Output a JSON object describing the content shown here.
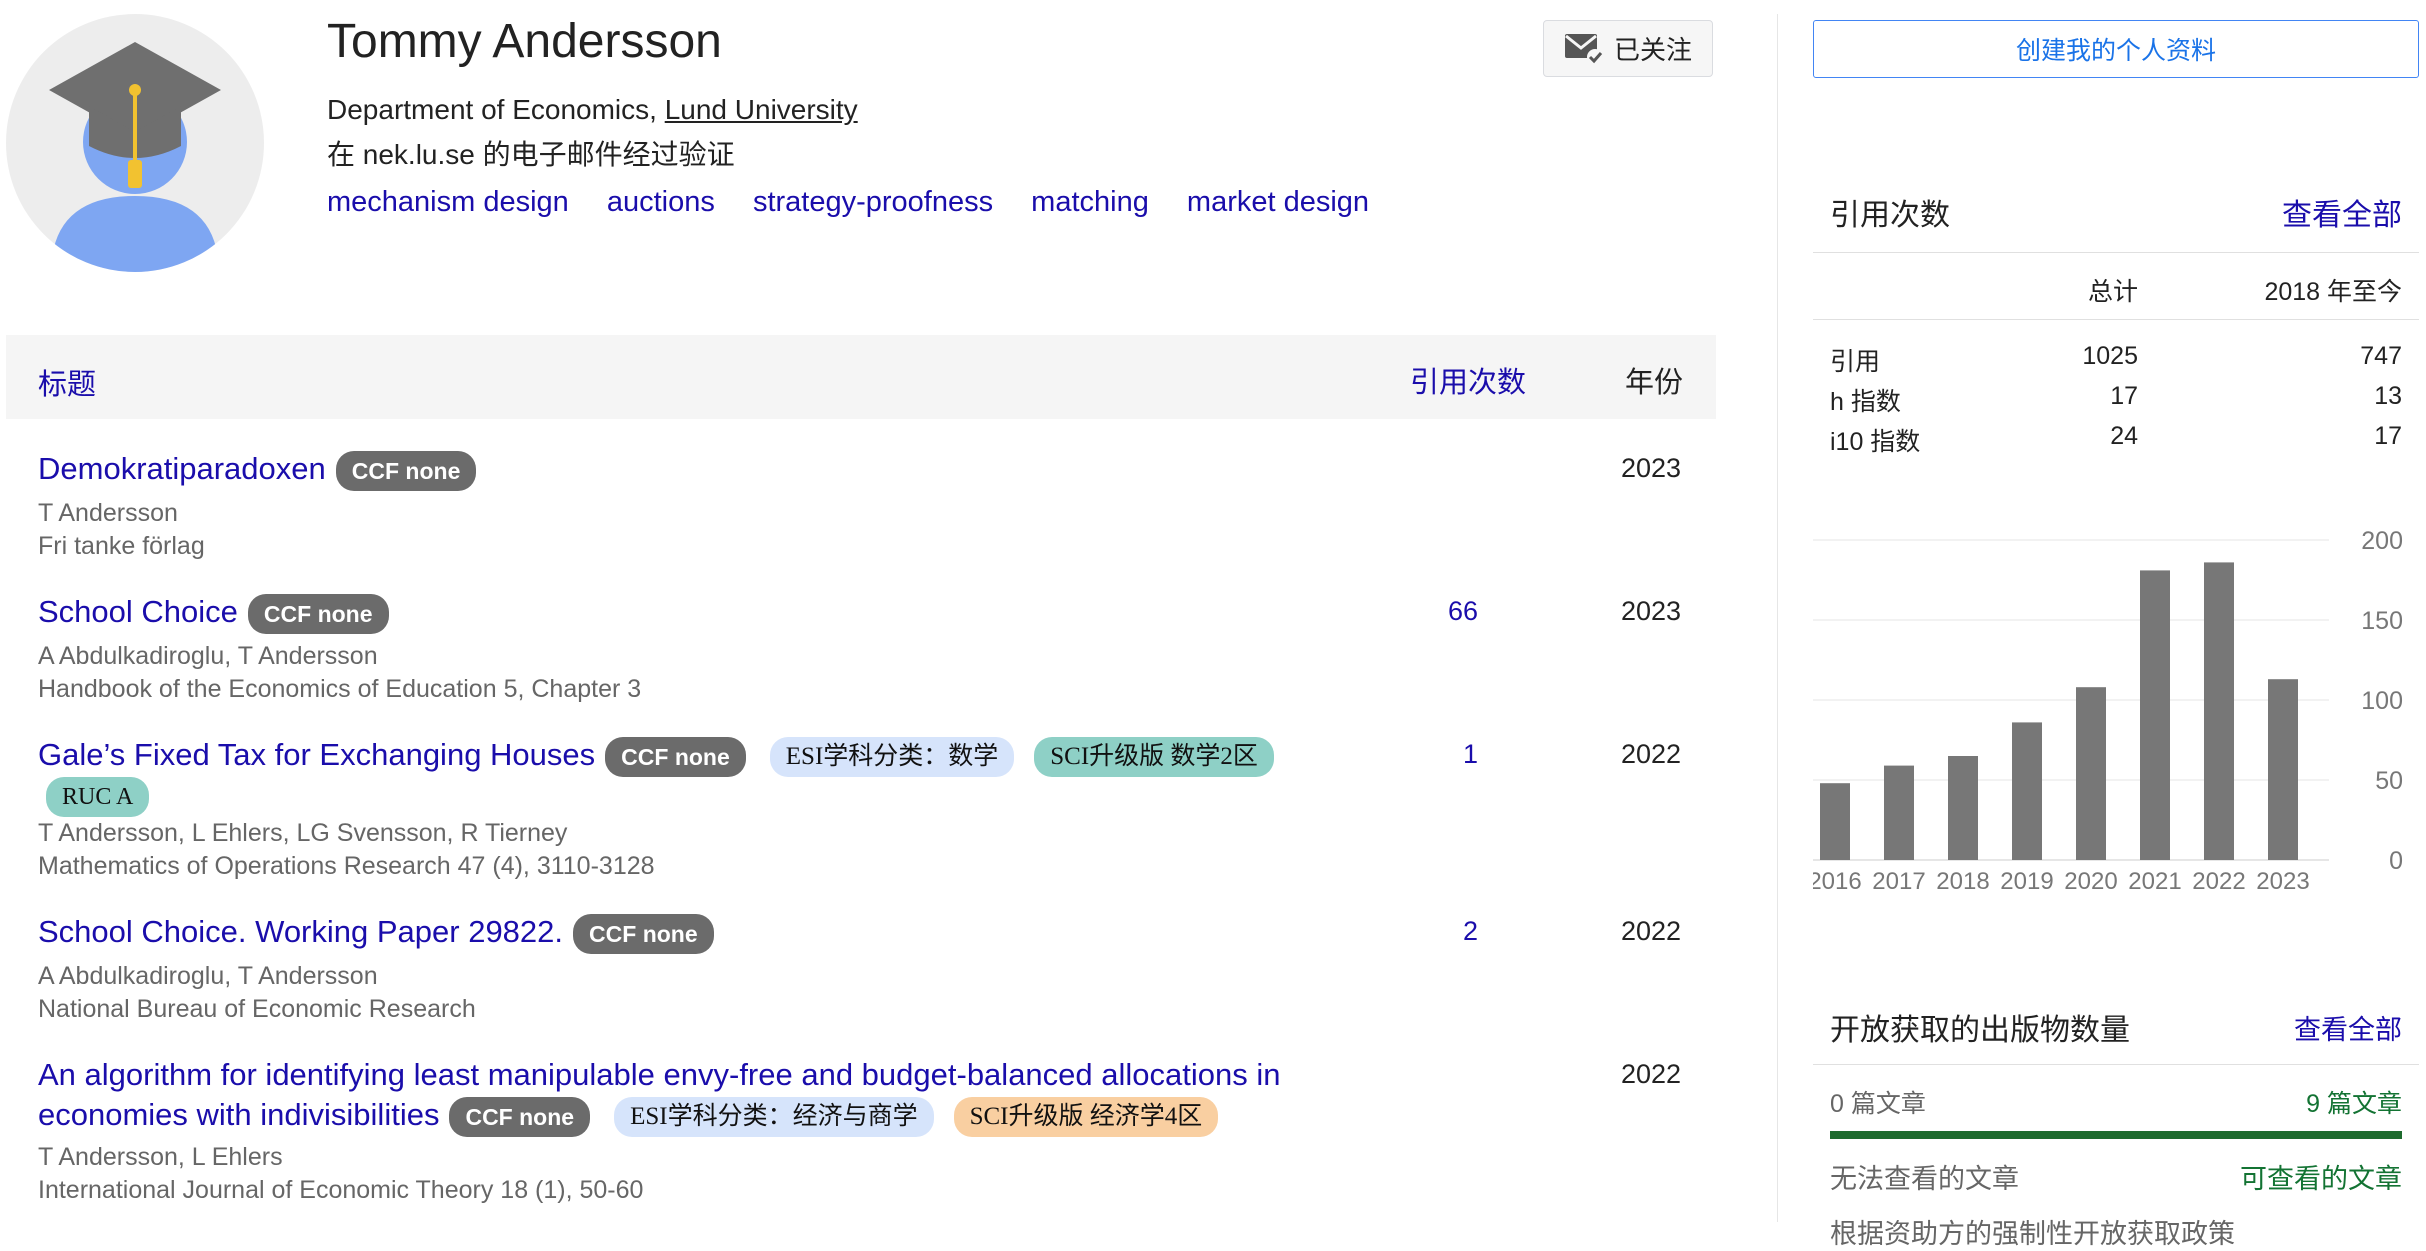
{
  "profile": {
    "name": "Tommy Andersson",
    "affiliation_prefix": "Department of Economics, ",
    "affiliation_univ": "Lund University",
    "verified": "在 nek.lu.se 的电子邮件经过验证",
    "interests": [
      "mechanism design",
      "auctions",
      "strategy-proofness",
      "matching",
      "market design"
    ],
    "follow_label": "已关注"
  },
  "table": {
    "col_title": "标题",
    "col_cites": "引用次数",
    "col_year": "年份",
    "ccf_badge": "CCF none",
    "rows": [
      {
        "title": "Demokratiparadoxen",
        "authors": "T Andersson",
        "venue": "Fri tanke förlag",
        "cites": "",
        "year": "2023"
      },
      {
        "title": "School Choice",
        "authors": "A Abdulkadiroglu, T Andersson",
        "venue": "Handbook of the Economics of Education 5, Chapter 3",
        "cites": "66",
        "year": "2023"
      },
      {
        "title": "Gale’s Fixed Tax for Exchanging Houses",
        "esi": "ESI学科分类：数学",
        "sci": "SCI升级版 数学2区",
        "ruc": "RUC A",
        "authors": "T Andersson, L Ehlers, LG Svensson, R Tierney",
        "venue": "Mathematics of Operations Research 47 (4), 3110-3128",
        "cites": "1",
        "year": "2022"
      },
      {
        "title": "School Choice. Working Paper 29822.",
        "authors": "A Abdulkadiroglu, T Andersson",
        "venue": "National Bureau of Economic Research",
        "cites": "2",
        "year": "2022"
      },
      {
        "title_line1": "An algorithm for identifying least manipulable envy-free and budget-balanced allocations in",
        "title_line2": "economies with indivisibilities",
        "esi": "ESI学科分类：经济与商学",
        "sci": "SCI升级版 经济学4区",
        "authors": "T Andersson, L Ehlers",
        "venue": "International Journal of Economic Theory 18 (1), 50-60",
        "cites": "",
        "year": "2022"
      }
    ]
  },
  "sidebar": {
    "create_profile": "创建我的个人资料",
    "citations": {
      "heading": "引用次数",
      "view_all": "查看全部",
      "col_total": "总计",
      "col_since": "2018 年至今",
      "rows": [
        {
          "label": "引用",
          "total": "1025",
          "since": "747"
        },
        {
          "label": "h 指数",
          "total": "17",
          "since": "13"
        },
        {
          "label": "i10 指数",
          "total": "24",
          "since": "17"
        }
      ]
    },
    "open_access": {
      "heading": "开放获取的出版物数量",
      "view_all": "查看全部",
      "left_count": "0 篇文章",
      "right_count": "9 篇文章",
      "left_label": "无法查看的文章",
      "right_label": "可查看的文章",
      "footer": "根据资助方的强制性开放获取政策"
    }
  },
  "colors": {
    "link": "#1a0dab",
    "bar": "#777777",
    "oa_green": "#1e6b2e"
  },
  "chart_data": {
    "type": "bar",
    "categories": [
      "2016",
      "2017",
      "2018",
      "2019",
      "2020",
      "2021",
      "2022",
      "2023"
    ],
    "values": [
      48,
      59,
      65,
      86,
      108,
      181,
      186,
      113
    ],
    "yticks": [
      "200",
      "150",
      "100",
      "50",
      "0"
    ],
    "ylim": [
      0,
      200
    ],
    "grid": true
  }
}
